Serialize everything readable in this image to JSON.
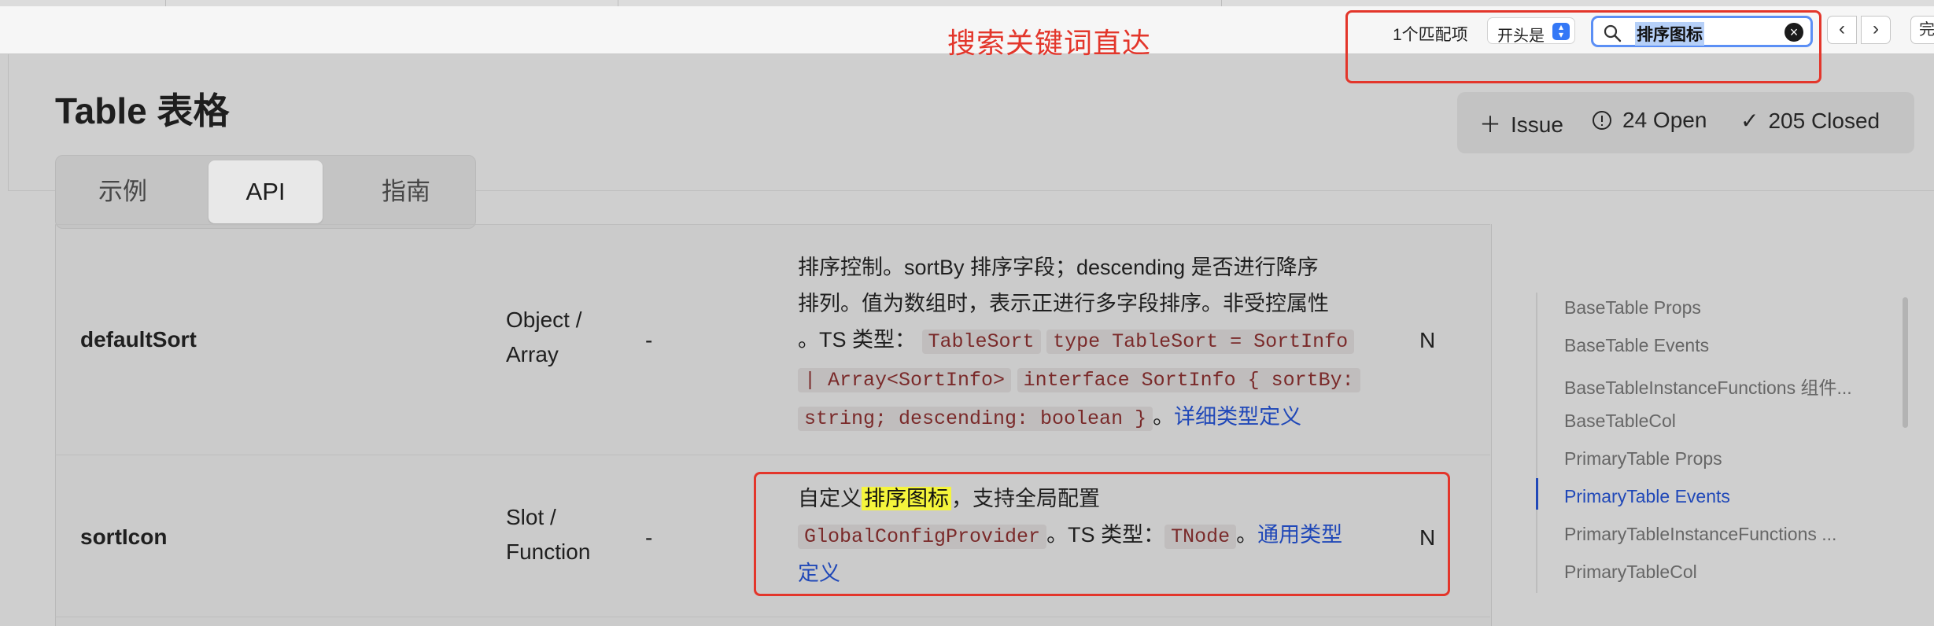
{
  "find_bar": {
    "annotation": "搜索关键词直达",
    "match_count": "1个匹配项",
    "mode": "开头是",
    "query": "排序图标",
    "done": "完",
    "prev_icon": "chevron-left-icon",
    "next_icon": "chevron-right-icon"
  },
  "page": {
    "title": "Table 表格",
    "tabs": [
      {
        "label": "示例",
        "active": false
      },
      {
        "label": "API",
        "active": true
      },
      {
        "label": "指南",
        "active": false
      }
    ]
  },
  "issues": {
    "new": "Issue",
    "open": "24 Open",
    "closed": "205 Closed"
  },
  "rows": [
    {
      "name": "defaultSort",
      "type_line1": "Object /",
      "type_line2": "Array",
      "default": "-",
      "required": "N",
      "desc": {
        "line1": "排序控制。sortBy 排序字段；descending 是否进行降序",
        "line2": "排列。值为数组时，表示正进行多字段排序。非受控属性",
        "line3_text": "。TS 类型：",
        "code1": "TableSort",
        "code2": "type TableSort = SortInfo",
        "code3": "| Array<SortInfo>",
        "code4": "interface SortInfo { sortBy:",
        "code5": "string; descending: boolean }",
        "sep": "。",
        "link": "详细类型定义"
      }
    },
    {
      "name": "sortIcon",
      "type_line1": "Slot /",
      "type_line2": "Function",
      "default": "-",
      "required": "N",
      "desc": {
        "prefix": "自定义",
        "highlight": "排序图标",
        "suffix": "，支持全局配置",
        "code1": "GlobalConfigProvider",
        "ts_text": "。TS 类型：",
        "code2": "TNode",
        "sep": "。",
        "link_part1": "通用类型",
        "link_part2": "定义"
      }
    }
  ],
  "toc": [
    {
      "label": "BaseTable Props",
      "active": false
    },
    {
      "label": "BaseTable Events",
      "active": false
    },
    {
      "label": "BaseTableInstanceFunctions 组件...",
      "active": false
    },
    {
      "label": "BaseTableCol",
      "active": false
    },
    {
      "label": "PrimaryTable Props",
      "active": false
    },
    {
      "label": "PrimaryTable Events",
      "active": true
    },
    {
      "label": "PrimaryTableInstanceFunctions ...",
      "active": false
    },
    {
      "label": "PrimaryTableCol",
      "active": false
    }
  ],
  "colors": {
    "annotation_red": "#e3362b",
    "link_blue": "#2048b8",
    "highlight_yellow": "#f5f53c",
    "search_focus": "#5b8ff5"
  }
}
